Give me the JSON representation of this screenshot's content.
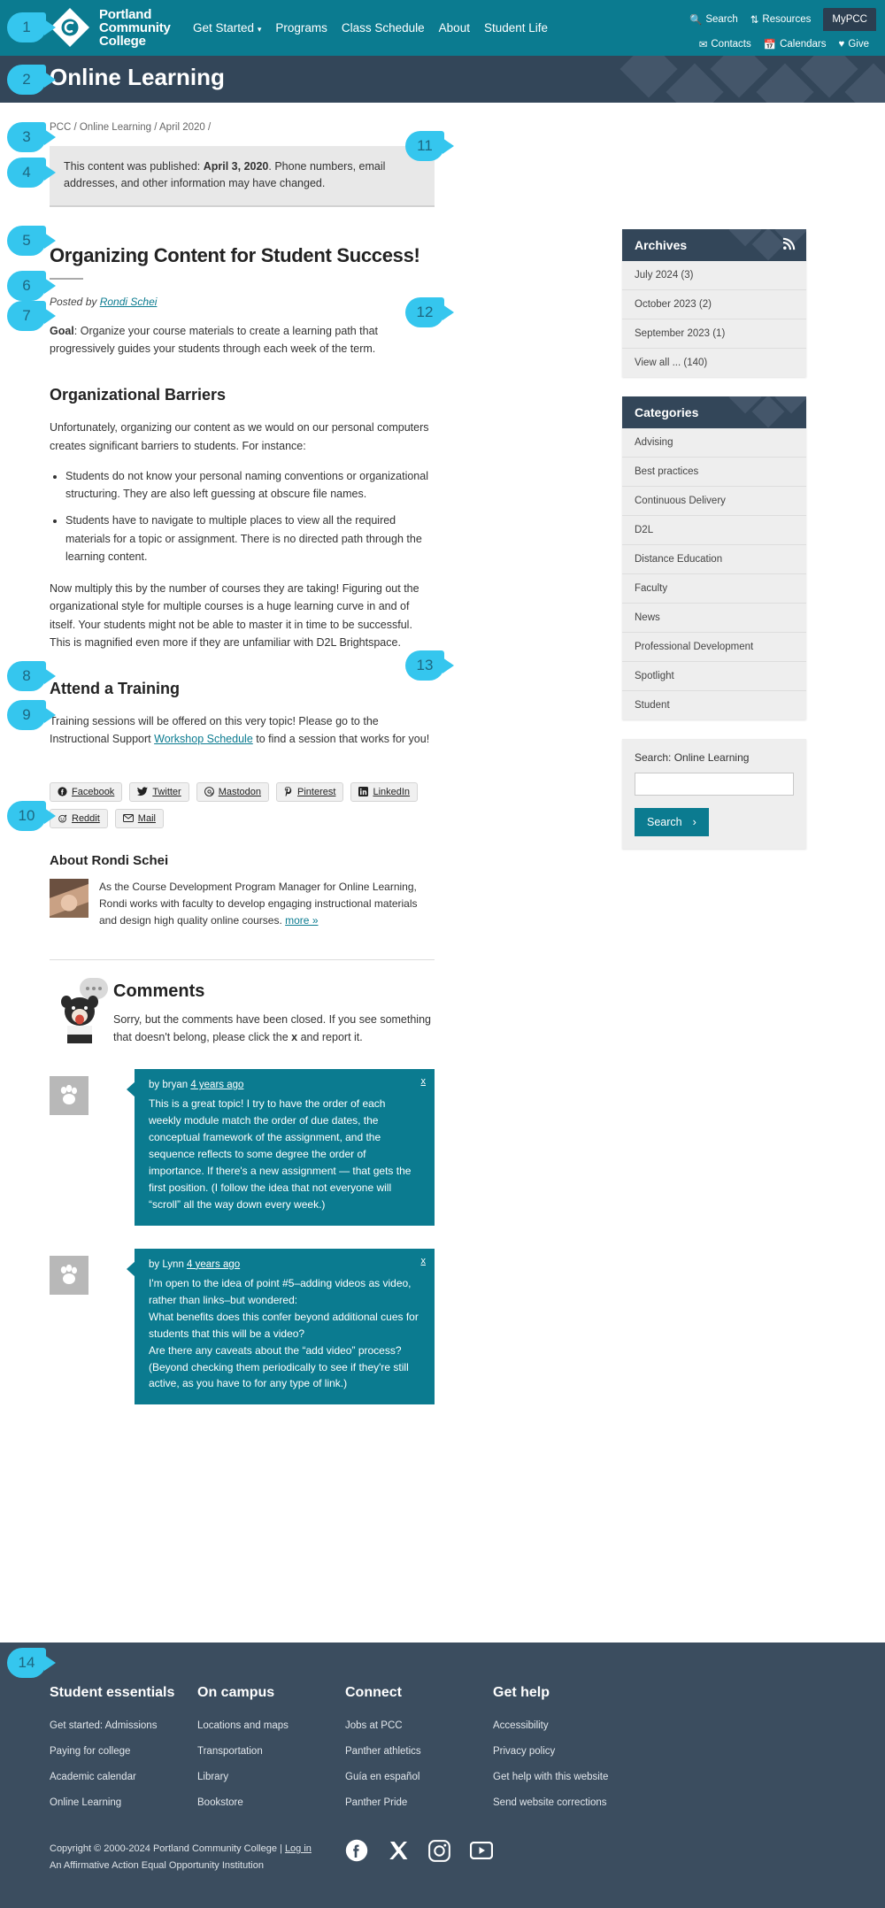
{
  "header": {
    "logo_line1": "Portland",
    "logo_line2": "Community",
    "logo_line3": "College",
    "nav": [
      {
        "label": "Get Started",
        "has_caret": true
      },
      {
        "label": "Programs",
        "has_caret": false
      },
      {
        "label": "Class Schedule",
        "has_caret": false
      },
      {
        "label": "About",
        "has_caret": false
      },
      {
        "label": "Student Life",
        "has_caret": false
      }
    ],
    "util_row1": [
      {
        "label": "Search",
        "icon": "search-icon"
      },
      {
        "label": "Resources",
        "icon": "resources-icon"
      },
      {
        "label": "MyPCC",
        "icon": "none"
      }
    ],
    "util_row2": [
      {
        "label": "Contacts",
        "icon": "envelope-icon"
      },
      {
        "label": "Calendars",
        "icon": "calendar-icon"
      },
      {
        "label": "Give",
        "icon": "heart-icon"
      }
    ]
  },
  "banner": {
    "title": "Online Learning"
  },
  "breadcrumb": "PCC / Online Learning / April 2020 /",
  "notice": {
    "pre": "This content was published: ",
    "date": "April 3, 2020",
    "post": ". Phone numbers, email addresses, and other information may have changed."
  },
  "article": {
    "title": "Organizing Content for Student Success!",
    "posted_by_label": "Posted by ",
    "author": "Rondi Schei",
    "goal_label": "Goal",
    "goal_text": ": Organize your course materials to create a learning path that progressively guides your students through each week of the term.",
    "section1_heading": "Organizational Barriers",
    "section1_intro": "Unfortunately, organizing our content as we would on our personal computers creates significant barriers to students. For instance:",
    "bullets": [
      "Students do not know your personal naming conventions or organizational structuring. They are also left guessing at obscure file names.",
      "Students have to navigate to multiple places to view all the required materials for a topic or assignment. There is no directed path through the learning content."
    ],
    "section1_outro": "Now multiply this by the number of courses they are taking! Figuring out the organizational style for multiple courses is a huge learning curve in and of itself. Your students might not be able to master it in time to be successful. This is magnified even more if they are unfamiliar with D2L Brightspace.",
    "section2_heading": "Attend a Training",
    "section2_pre": "Training sessions will be offered on this very topic!  Please go to the Instructional Support  ",
    "section2_link": "Workshop Schedule",
    "section2_post": " to find a session that works for you!"
  },
  "share": [
    {
      "label": "Facebook",
      "icon": "facebook-icon"
    },
    {
      "label": "Twitter",
      "icon": "twitter-icon"
    },
    {
      "label": "Mastodon",
      "icon": "mastodon-icon"
    },
    {
      "label": "Pinterest",
      "icon": "pinterest-icon"
    },
    {
      "label": "LinkedIn",
      "icon": "linkedin-icon"
    },
    {
      "label": "Reddit",
      "icon": "reddit-icon"
    },
    {
      "label": "Mail",
      "icon": "mail-icon"
    }
  ],
  "about": {
    "heading": "About Rondi Schei",
    "bio": "As the Course Development Program Manager for Online Learning, Rondi works with faculty to develop engaging instructional materials and design high quality online courses. ",
    "more_link": "more »"
  },
  "comments": {
    "heading": "Comments",
    "closed_pre": "Sorry, but the comments have been closed. If you see something that doesn't belong, please click the ",
    "closed_x": "x",
    "closed_post": " and report it.",
    "close_label": "x",
    "items": [
      {
        "by_label": "by bryan ",
        "time": "4 years ago",
        "text": "This is a great topic! I try to have the order of each weekly module match the order of due dates, the conceptual framework of the assignment, and the sequence reflects to some degree the order of importance. If there's a new assignment — that gets the first position. (I follow the idea that not everyone will “scroll” all the way down every week.)"
      },
      {
        "by_label": "by Lynn ",
        "time": "4 years ago",
        "text": "I'm open to the idea of point #5–adding videos as video, rather than links–but wondered:\nWhat benefits does this confer beyond additional cues for students that this will be a video?\nAre there any caveats about the “add video” process? (Beyond checking them periodically to see if they're still active, as you have to for any type of link.)"
      }
    ]
  },
  "sidebar": {
    "archives": {
      "title": "Archives",
      "rss_icon": "rss-icon",
      "items": [
        "July 2024 (3)",
        "October 2023 (2)",
        "September 2023 (1)",
        "View all ... (140)"
      ]
    },
    "categories": {
      "title": "Categories",
      "items": [
        "Advising",
        "Best practices",
        "Continuous Delivery",
        "D2L",
        "Distance Education",
        "Faculty",
        "News",
        "Professional Development",
        "Spotlight",
        "Student"
      ]
    },
    "search": {
      "label": "Search: Online Learning",
      "value": "",
      "placeholder": "",
      "button": "Search"
    }
  },
  "footer": {
    "columns": [
      {
        "heading": "Student essentials",
        "links": [
          "Get started: Admissions",
          "Paying for college",
          "Academic calendar",
          "Online Learning"
        ]
      },
      {
        "heading": "On campus",
        "links": [
          "Locations and maps",
          "Transportation",
          "Library",
          "Bookstore"
        ]
      },
      {
        "heading": "Connect",
        "links": [
          "Jobs at PCC",
          "Panther athletics",
          "Guía en español",
          "Panther Pride"
        ]
      },
      {
        "heading": "Get help",
        "links": [
          "Accessibility",
          "Privacy policy",
          "Get help with this website",
          "Send website corrections"
        ]
      }
    ],
    "copyright_pre": "Copyright © 2000-2024 Portland Community College | ",
    "login": "Log in",
    "affirmative": "An Affirmative Action Equal Opportunity Institution",
    "social": [
      "facebook-icon",
      "x-icon",
      "instagram-icon",
      "youtube-icon"
    ]
  },
  "callouts": [
    {
      "n": "1"
    },
    {
      "n": "2"
    },
    {
      "n": "3"
    },
    {
      "n": "4"
    },
    {
      "n": "5"
    },
    {
      "n": "6"
    },
    {
      "n": "7"
    },
    {
      "n": "8"
    },
    {
      "n": "9"
    },
    {
      "n": "10"
    },
    {
      "n": "11"
    },
    {
      "n": "12"
    },
    {
      "n": "13"
    },
    {
      "n": "14"
    }
  ],
  "colors": {
    "teal": "#0b7b90",
    "navy": "#334659",
    "footer": "#3b4d5f",
    "callout": "#35c6ee"
  }
}
